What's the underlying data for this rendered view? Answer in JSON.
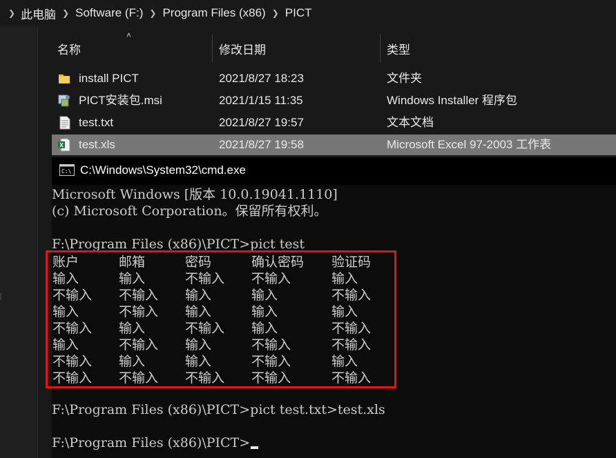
{
  "breadcrumb": [
    "此电脑",
    "Software (F:)",
    "Program Files (x86)",
    "PICT"
  ],
  "columns": {
    "name": "名称",
    "date": "修改日期",
    "type": "类型"
  },
  "files": [
    {
      "name": "install PICT",
      "date": "2021/8/27 18:23",
      "type": "文件夹",
      "icon": "folder-icon"
    },
    {
      "name": "PICT安装包.msi",
      "date": "2021/1/15 11:35",
      "type": "Windows Installer 程序包",
      "icon": "msi-installer-icon"
    },
    {
      "name": "test.txt",
      "date": "2021/8/27 19:57",
      "type": "文本文档",
      "icon": "text-file-icon"
    },
    {
      "name": "test.xls",
      "date": "2021/8/27 19:58",
      "type": "Microsoft Excel 97-2003 工作表",
      "icon": "excel-file-icon",
      "selected": true
    }
  ],
  "cmd": {
    "title": "C:\\Windows\\System32\\cmd.exe",
    "banner1": "Microsoft Windows [版本 10.0.19041.1110]",
    "banner2": "(c) Microsoft Corporation。保留所有权利。",
    "cmd1": "F:\\Program Files (x86)\\PICT>pict test",
    "table": {
      "headers": [
        "账户",
        "邮箱",
        "密码",
        "确认密码",
        "验证码"
      ],
      "rows": [
        [
          "输入",
          "输入",
          "不输入",
          "不输入",
          "输入"
        ],
        [
          "不输入",
          "不输入",
          "输入",
          "输入",
          "不输入"
        ],
        [
          "输入",
          "不输入",
          "输入",
          "输入",
          "输入"
        ],
        [
          "不输入",
          "输入",
          "不输入",
          "输入",
          "不输入"
        ],
        [
          "输入",
          "不输入",
          "输入",
          "不输入",
          "不输入"
        ],
        [
          "不输入",
          "输入",
          "输入",
          "不输入",
          "输入"
        ],
        [
          "不输入",
          "不输入",
          "不输入",
          "不输入",
          "不输入"
        ]
      ]
    },
    "cmd2": "F:\\Program Files (x86)\\PICT>pict test.txt>test.xls",
    "prompt": "F:\\Program Files (x86)\\PICT>"
  },
  "colors": {
    "highlight_box": "#e0161b",
    "selected_row": "#777777",
    "console_bg": "#0c0c0c"
  }
}
